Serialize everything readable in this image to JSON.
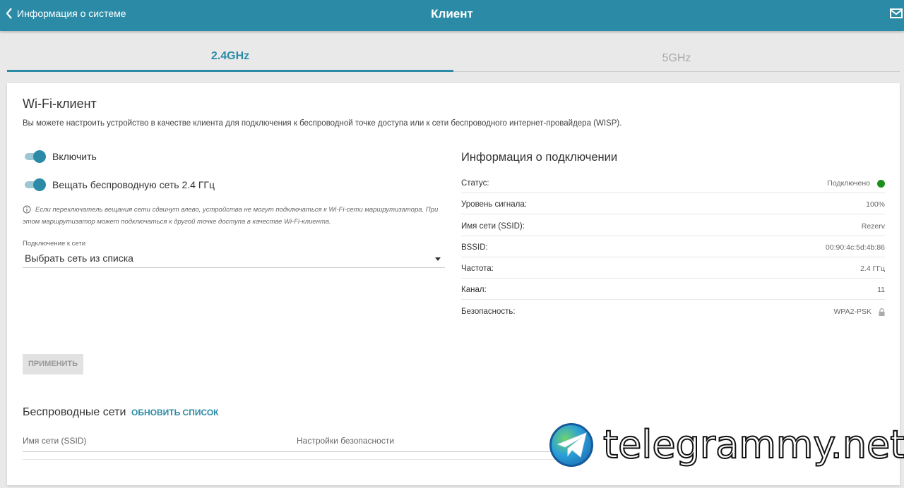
{
  "header": {
    "back_label": "Информация о системе",
    "title": "Клиент"
  },
  "tabs": [
    {
      "label": "2.4GHz",
      "active": true
    },
    {
      "label": "5GHz",
      "active": false
    }
  ],
  "wifi_client": {
    "title": "Wi-Fi-клиент",
    "description": "Вы можете настроить устройство в качестве клиента для подключения к беспроводной точке доступа или к сети беспроводного интернет-провайдера (WISP).",
    "enable_label": "Включить",
    "enable_on": true,
    "broadcast_label": "Вещать беспроводную сеть 2.4 ГГц",
    "broadcast_on": true,
    "note": "Если переключатель вещания сети сдвинут влево, устройства не могут подключаться к Wi-Fi-сети маршрутизатора. При этом маршрутизатор может подключаться к другой точке доступа в качестве Wi-Fi-клиента.",
    "connection_label": "Подключение к сети",
    "connection_value": "Выбрать сеть из списка",
    "apply_label": "ПРИМЕНИТЬ"
  },
  "connection_info": {
    "title": "Информация о подключении",
    "rows": [
      {
        "key": "Статус:",
        "value": "Подключено"
      },
      {
        "key": "Уровень сигнала:",
        "value": "100%"
      },
      {
        "key": "Имя сети (SSID):",
        "value": "Rezerv"
      },
      {
        "key": "BSSID:",
        "value": "00:90:4c:5d:4b:86"
      },
      {
        "key": "Частота:",
        "value": "2.4 ГГц"
      },
      {
        "key": "Канал:",
        "value": "11"
      },
      {
        "key": "Безопасность:",
        "value": "WPA2-PSK"
      }
    ],
    "status_color": "#1b8f1b"
  },
  "wireless_networks": {
    "title": "Беспроводные сети",
    "refresh_label": "ОБНОВИТЬ СПИСОК",
    "columns": [
      "Имя сети (SSID)",
      "Настройки безопасности"
    ]
  },
  "watermark": {
    "text": "telegrammy.net"
  },
  "colors": {
    "accent": "#2b8ba7",
    "header_bg": "#2b8ba7"
  }
}
